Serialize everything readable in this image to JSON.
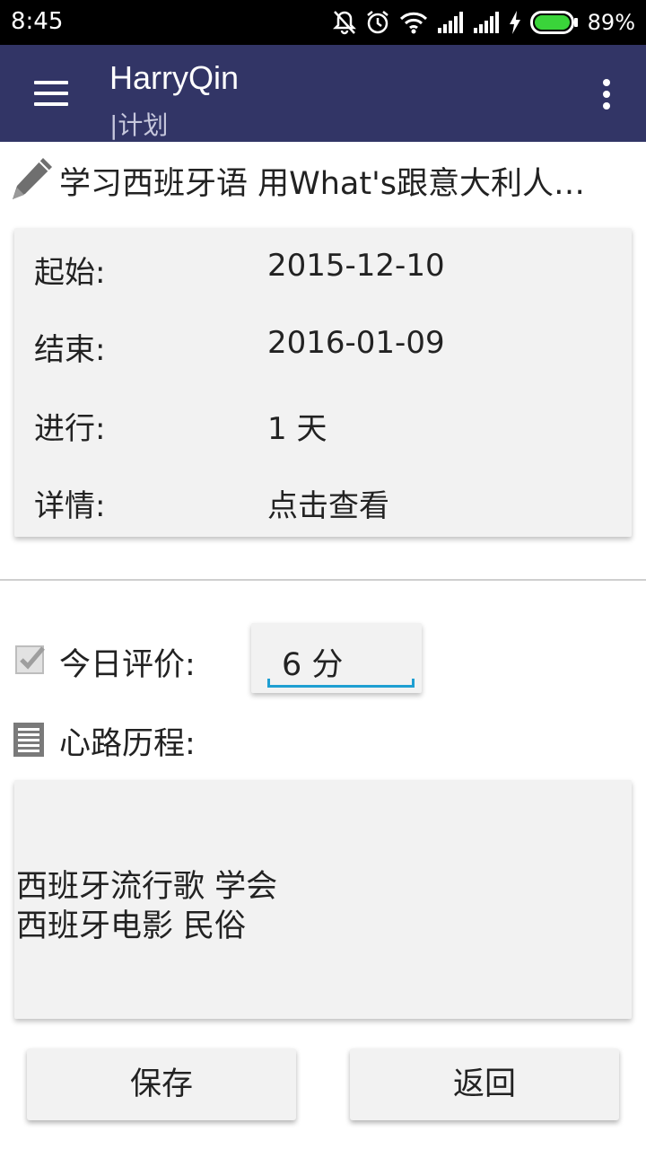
{
  "status_bar": {
    "time": "8:45",
    "battery_percent": "89%",
    "icons": [
      "mute-icon",
      "alarm-icon",
      "wifi-icon",
      "signal-icon",
      "signal-icon",
      "charging-icon",
      "battery-icon"
    ]
  },
  "app_bar": {
    "title": "HarryQin",
    "subtitle": "|计划",
    "icons": [
      "menu-icon",
      "more-vert-icon"
    ]
  },
  "plan": {
    "icon": "pencil-icon",
    "name": "学习西班牙语 用What's跟意大利人…"
  },
  "details": [
    {
      "label": "起始:",
      "value": "2015-12-10"
    },
    {
      "label": "结束:",
      "value": "2016-01-09"
    },
    {
      "label": "进行:",
      "value": "1 天"
    },
    {
      "label": "详情:",
      "value": "点击查看"
    }
  ],
  "rating": {
    "icon": "checkbox-icon",
    "label": "今日评价:",
    "value": "6  分"
  },
  "journey": {
    "icon": "document-icon",
    "label": "心路历程:",
    "lines": [
      "西班牙流行歌 学会",
      "西班牙电影 民俗"
    ]
  },
  "buttons": {
    "save": "保存",
    "back": "返回"
  },
  "colors": {
    "app_bar": "#323566",
    "accent": "#1f9fd2",
    "card": "#f2f2f2"
  }
}
